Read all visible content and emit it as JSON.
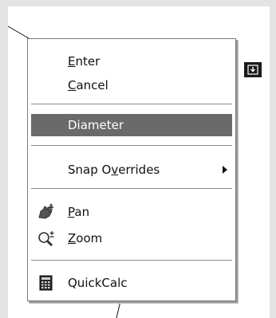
{
  "menu": {
    "items": [
      {
        "pre": "",
        "key": "E",
        "post": "nter"
      },
      {
        "pre": "",
        "key": "C",
        "post": "ancel"
      },
      {
        "pre": "",
        "key": "",
        "post": "Diameter"
      },
      {
        "pre": "Snap O",
        "key": "v",
        "post": "errides"
      },
      {
        "pre": "",
        "key": "P",
        "post": "an"
      },
      {
        "pre": "",
        "key": "Z",
        "post": "oom"
      },
      {
        "pre": "",
        "key": "",
        "post": "QuickCalc"
      }
    ],
    "highlighted_item": "Diameter"
  },
  "icons": {
    "pan": "pan-hand-icon",
    "zoom": "zoom-magnifier-icon",
    "quickcalc": "calculator-icon",
    "grip": "download-arrow-icon",
    "submenu": "submenu-arrow-icon"
  },
  "colors": {
    "highlight": "#6a6a6a",
    "background": "#e4e4e4"
  }
}
